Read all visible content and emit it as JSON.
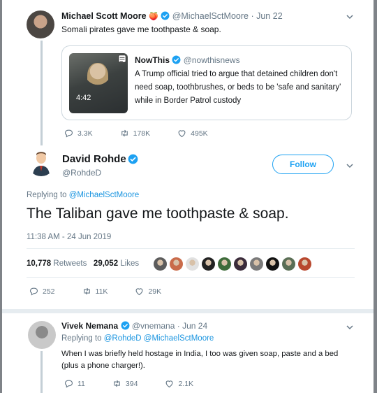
{
  "tweet1": {
    "name": "Michael Scott Moore",
    "emoji": "🍑",
    "handle": "@MichaelSctMoore",
    "date": "Jun 22",
    "text": "Somali pirates gave me toothpaste & soap.",
    "embed": {
      "name": "NowThis",
      "handle": "@nowthisnews",
      "text": "A Trump official tried to argue that detained children don't need soap, toothbrushes, or beds to be 'safe and sanitary' while in Border Patrol custody",
      "duration": "4:42"
    },
    "replies": "3.3K",
    "retweets": "178K",
    "likes": "495K"
  },
  "main": {
    "name": "David Rohde",
    "handle": "@RohdeD",
    "follow_label": "Follow",
    "replying_prefix": "Replying to ",
    "replying_to": "@MichaelSctMoore",
    "text": "The Taliban gave me toothpaste & soap.",
    "timestamp": "11:38 AM - 24 Jun 2019",
    "retweet_count": "10,778",
    "retweet_label": "Retweets",
    "like_count": "29,052",
    "like_label": "Likes",
    "replies": "252",
    "retweets": "11K",
    "likes": "29K"
  },
  "reply": {
    "name": "Vivek Nemana",
    "handle": "@vnemana",
    "date": "Jun 24",
    "replying_prefix": "Replying to ",
    "replying_to": "@RohdeD @MichaelSctMoore",
    "text_line1": "When I was briefly held hostage in India, I too was given soap, paste and a bed",
    "text_line2": "(plus a phone charger!).",
    "replies": "11",
    "retweets": "394",
    "likes": "2.1K"
  },
  "colors": {
    "accent": "#1b95e0",
    "muted": "#657786",
    "liker_colors": [
      "#5c5c5c",
      "#c96b4a",
      "#e1e1e1",
      "#222222",
      "#3d6b3a",
      "#3a2b3a",
      "#7a7a7a",
      "#111111",
      "#5a6e55",
      "#b8472d"
    ]
  },
  "icons": [
    "verified-badge-icon",
    "chevron-down-icon",
    "reply-icon",
    "retweet-icon",
    "like-icon",
    "media-icon"
  ]
}
